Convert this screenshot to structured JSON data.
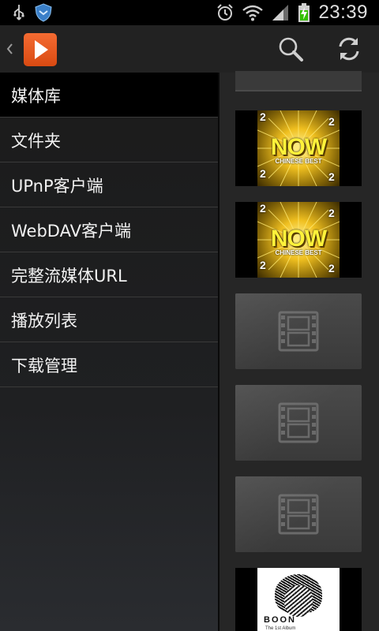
{
  "status_bar": {
    "time": "23:39",
    "icons": [
      "usb-icon",
      "shield-icon",
      "alarm-icon",
      "wifi-icon",
      "signal-icon",
      "battery-charging-icon"
    ]
  },
  "action_bar": {
    "icons": [
      "back-chevron-icon",
      "app-logo-play-icon",
      "search-icon",
      "refresh-icon"
    ]
  },
  "drawer": {
    "items": [
      {
        "label": "媒体库",
        "selected": true
      },
      {
        "label": "文件夹"
      },
      {
        "label": "UPnP客户端"
      },
      {
        "label": "WebDAV客户端"
      },
      {
        "label": "完整流媒体URL"
      },
      {
        "label": "播放列表"
      },
      {
        "label": "下载管理"
      }
    ]
  },
  "content": {
    "album": {
      "title": "NOW",
      "subtitle": "CHINESE BEST",
      "number": "2"
    },
    "last_card": {
      "name": "BOON",
      "tag": "The 1st Album"
    }
  },
  "colors": {
    "accent": "#e8541c",
    "drawer_bg": "#1f2022",
    "actionbar_bg": "#222222",
    "placeholder_card": "#424242"
  }
}
